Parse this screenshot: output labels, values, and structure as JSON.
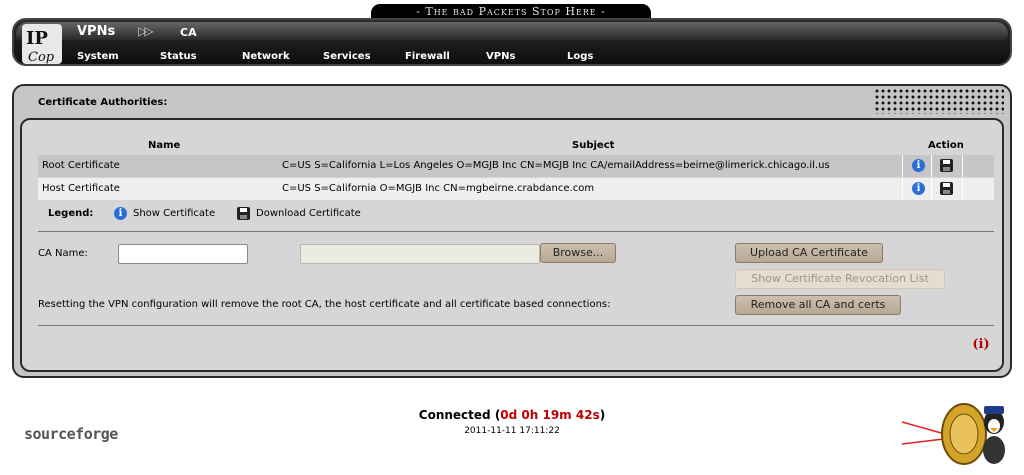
{
  "slogan": "- The bad Packets Stop Here -",
  "header": {
    "section": "VPNs",
    "separator": "▷▷",
    "page": "CA",
    "nav": [
      "System",
      "Status",
      "Network",
      "Services",
      "Firewall",
      "VPNs",
      "Logs"
    ]
  },
  "panel": {
    "title": "Certificate Authorities:",
    "columns": {
      "name": "Name",
      "subject": "Subject",
      "action": "Action"
    },
    "rows": [
      {
        "name": "Root Certificate",
        "subject": "C=US S=California L=Los Angeles O=MGJB Inc CN=MGJB Inc CA/emailAddress=beirne@limerick.chicago.il.us",
        "icon_show": "info-icon",
        "icon_download": "floppy-disk-icon"
      },
      {
        "name": "Host Certificate",
        "subject": "C=US S=California O=MGJB Inc CN=mgbeirne.crabdance.com",
        "icon_show": "info-icon",
        "icon_download": "floppy-disk-icon"
      }
    ],
    "legend": {
      "label": "Legend:",
      "show": "Show Certificate",
      "download": "Download Certificate"
    },
    "form": {
      "ca_name_label": "CA Name:",
      "ca_name_value": "",
      "file_value": "",
      "browse_label": "Browse...",
      "upload_label": "Upload CA Certificate",
      "crl_label": "Show Certificate Revocation List",
      "reset_text": "Resetting the VPN configuration will remove the root CA, the host certificate and all certificate based connections:",
      "remove_label": "Remove all CA and certs"
    },
    "help_glyph": "(i)"
  },
  "footer": {
    "brand": "sourceforge",
    "status_prefix": "Connected (",
    "uptime": "0d 0h 19m 42s",
    "status_suffix": ")",
    "timestamp": "2011-11-11 17:11:22"
  },
  "colors": {
    "accent_red": "#c00000",
    "header_bg": "#1a1a1a",
    "panel_bg": "#c6c6c6",
    "button": "#c4b6a4"
  }
}
